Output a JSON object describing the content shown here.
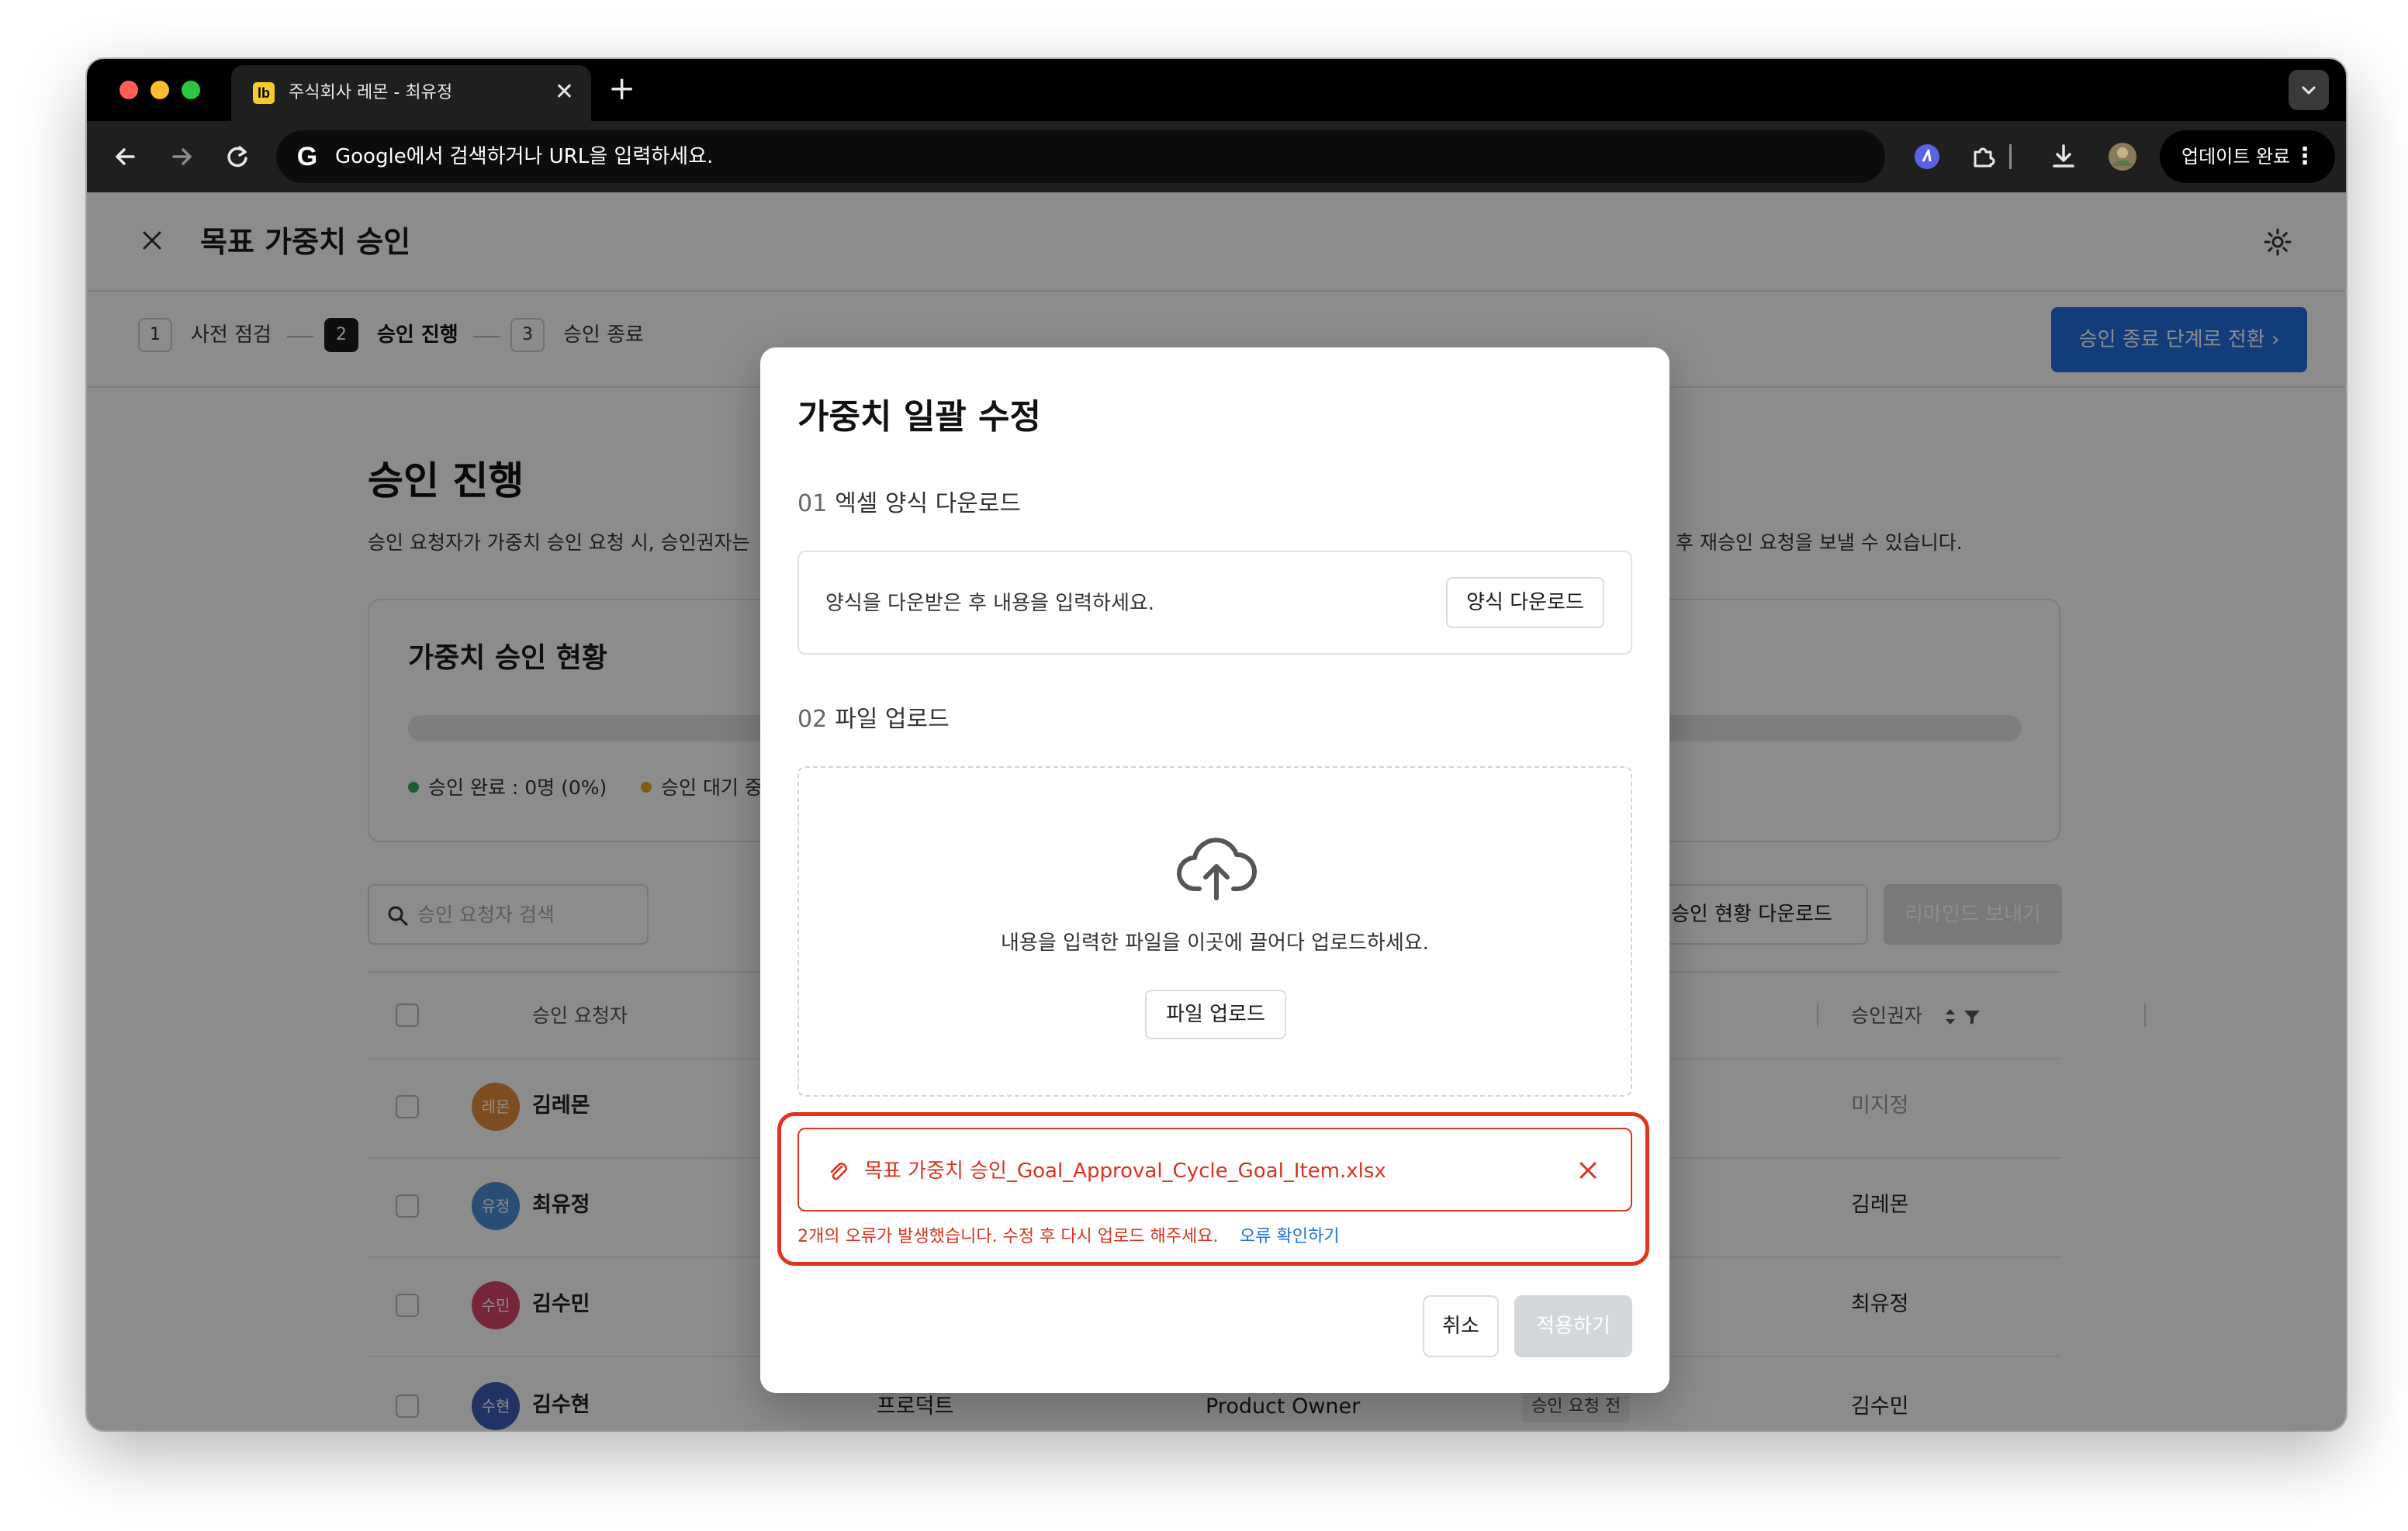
{
  "browser": {
    "tab_title": "주식회사 레몬 - 최유정",
    "tab_favicon_text": "lb",
    "tab_close": "✕",
    "new_tab": "+",
    "omnibox_placeholder": "Google에서 검색하거나 URL을 입력하세요.",
    "update_label": "업데이트 완료",
    "update_menu": "⋮"
  },
  "header": {
    "title": "목표 가중치 승인"
  },
  "steps": [
    {
      "num": "1",
      "label": "사전 점검"
    },
    {
      "num": "2",
      "label": "승인 진행"
    },
    {
      "num": "3",
      "label": "승인 종료"
    }
  ],
  "step_action": "승인 종료 단계로 전환 ›",
  "section": {
    "title": "승인 진행",
    "desc_left": "승인 요청자가 가중치 승인 요청 시, 승인권자는",
    "desc_right": "후 재승인 요청을 보낼 수 있습니다."
  },
  "status_card": {
    "title": "가중치 승인 현황",
    "legend_done": "승인 완료 : 0명 (0%)",
    "legend_wait": "승인 대기 중",
    "done_color": "#2faa5a",
    "wait_color": "#e7a92a"
  },
  "toolbar": {
    "search_placeholder": "승인 요청자 검색",
    "download_label": "승인 현황 다운로드",
    "remind_label": "리마인드 보내기"
  },
  "table": {
    "headers": {
      "requester": "승인 요청자",
      "approver": "승인권자"
    },
    "rows": [
      {
        "avatar": "레몬",
        "name": "김레몬",
        "approver": "미지정",
        "color": "#e58a3c"
      },
      {
        "avatar": "유정",
        "name": "최유정",
        "approver": "김레몬",
        "color": "#4a8fd6"
      },
      {
        "avatar": "수민",
        "name": "김수민",
        "approver": "최유정",
        "color": "#d9456b"
      },
      {
        "avatar": "수현",
        "name": "김수현",
        "dept": "프로덕트",
        "role": "Product Owner",
        "status": "승인 요청 전",
        "approver": "김수민",
        "color": "#3d5bb8"
      }
    ]
  },
  "modal": {
    "title": "가중치 일괄 수정",
    "step1_num": "01",
    "step1_label": "엑셀 양식 다운로드",
    "template_hint": "양식을 다운받은 후 내용을 입력하세요.",
    "template_button": "양식 다운로드",
    "step2_num": "02",
    "step2_label": "파일 업로드",
    "drop_hint": "내용을 입력한 파일을 이곳에 끌어다 업로드하세요.",
    "upload_button": "파일 업로드",
    "file_name": "목표 가중치 승인_Goal_Approval_Cycle_Goal_Item.xlsx",
    "error_message": "2개의 오류가 발생했습니다. 수정 후 다시 업로드 해주세요.",
    "error_link": "오류 확인하기",
    "cancel_button": "취소",
    "apply_button": "적용하기",
    "error_color": "#e0341f"
  },
  "help": {
    "label": "?"
  }
}
